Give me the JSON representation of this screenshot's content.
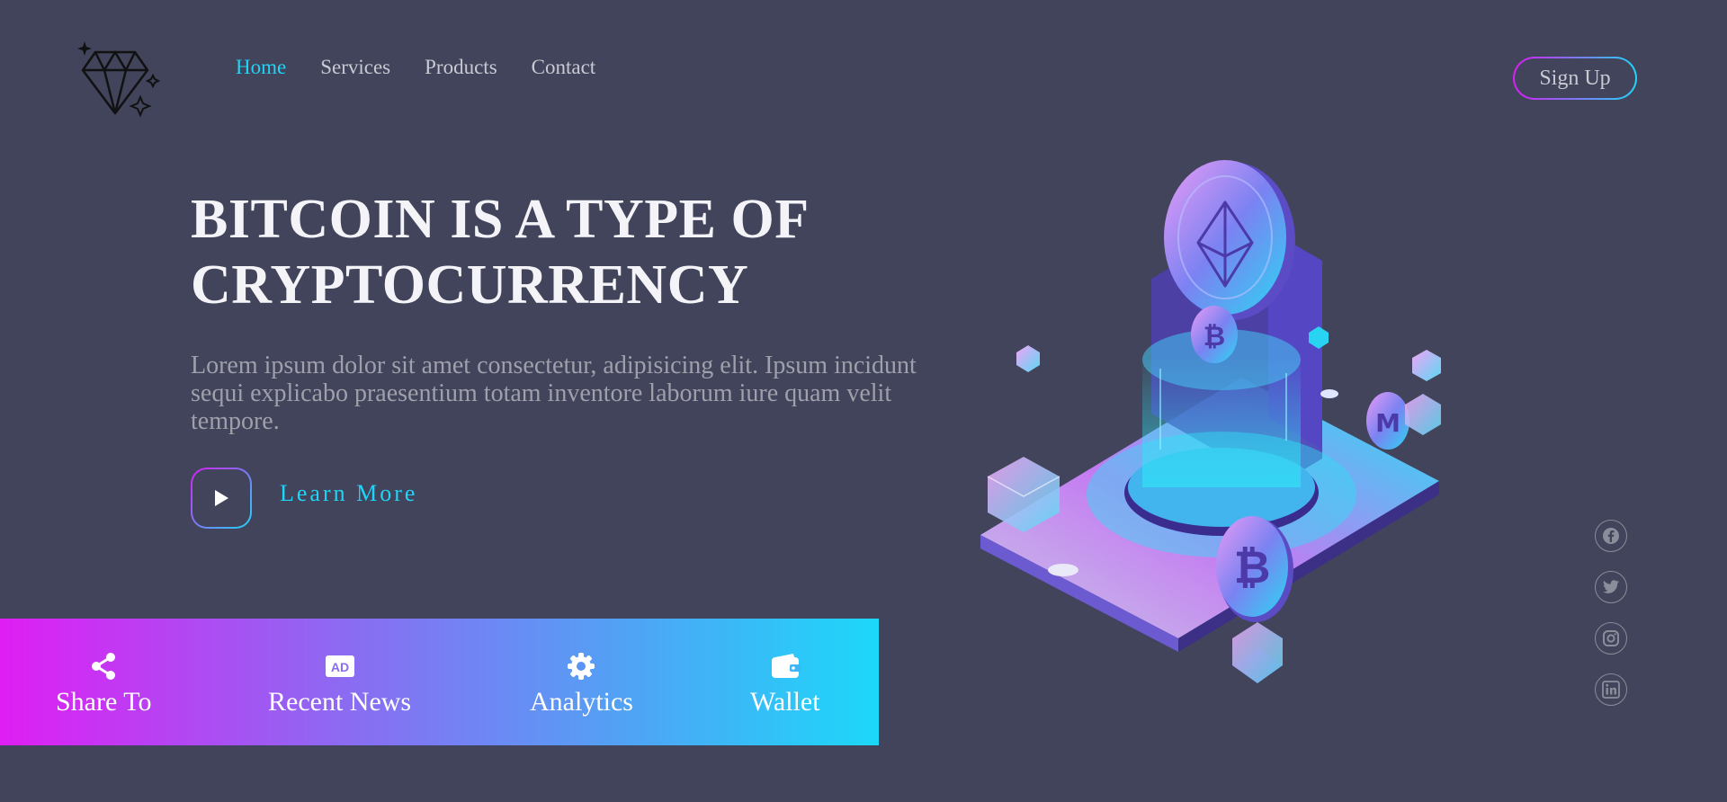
{
  "nav": {
    "items": [
      {
        "label": "Home",
        "active": true
      },
      {
        "label": "Services",
        "active": false
      },
      {
        "label": "Products",
        "active": false
      },
      {
        "label": "Contact",
        "active": false
      }
    ],
    "signup_label": "Sign Up"
  },
  "hero": {
    "title_line1": "BITCOIN IS A TYPE OF",
    "title_line2": "CRYPTOCURRENCY",
    "text": "Lorem ipsum dolor sit amet consectetur, adipisicing elit. Ipsum incidunt sequi explicabo praesentium totam inventore laborum iure quam velit tempore.",
    "learn_more": "Learn More"
  },
  "features": [
    {
      "label": "Share To",
      "icon": "share-icon"
    },
    {
      "label": "Recent News",
      "icon": "ad-icon"
    },
    {
      "label": "Analytics",
      "icon": "gear-icon"
    },
    {
      "label": "Wallet",
      "icon": "wallet-icon"
    }
  ],
  "social": [
    "facebook-icon",
    "twitter-icon",
    "instagram-icon",
    "linkedin-icon"
  ],
  "colors": {
    "background": "#41445a",
    "accent_cyan": "#21d4f7",
    "accent_magenta": "#d81ef5"
  }
}
